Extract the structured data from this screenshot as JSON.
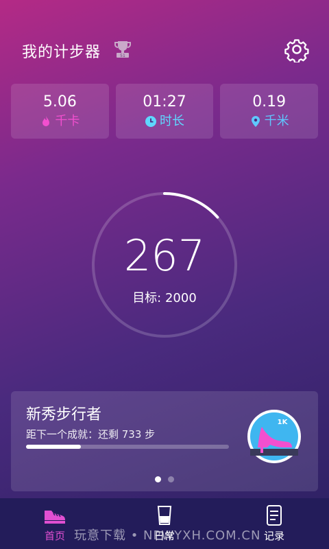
{
  "header": {
    "title": "我的计步器",
    "trophy_icon": "trophy-icon",
    "settings_icon": "gear-icon"
  },
  "stats": [
    {
      "value": "5.06",
      "label": "千卡",
      "icon": "flame-icon",
      "color": "#f24fcf"
    },
    {
      "value": "01:27",
      "label": "时长",
      "icon": "clock-icon",
      "color": "#5fd8ff"
    },
    {
      "value": "0.19",
      "label": "千米",
      "icon": "location-pin-icon",
      "color": "#5fc8ff"
    }
  ],
  "progress": {
    "steps": "267",
    "goal_text": "目标: 2000",
    "fraction": 0.1335
  },
  "achievement": {
    "title": "新秀步行者",
    "subtitle": "距下一个成就：还剩 733 步",
    "progress_fraction": 0.27,
    "badge_label": "1K",
    "page_count": 2,
    "active_page": 0
  },
  "tabs": [
    {
      "label": "首页",
      "icon": "shoe-icon",
      "active": true
    },
    {
      "label": "日常",
      "icon": "cup-icon",
      "active": false
    },
    {
      "label": "记录",
      "icon": "document-icon",
      "active": false
    }
  ],
  "watermark": "玩意下载 • NPWYXH.COM.CN",
  "colors": {
    "accent": "#e14fd2",
    "tabbar_bg": "#231c5a"
  }
}
